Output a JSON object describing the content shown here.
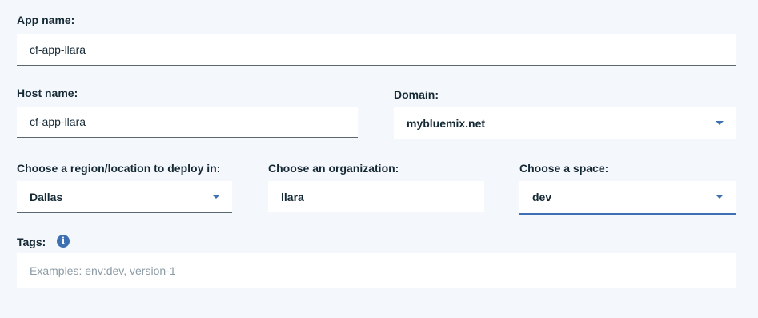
{
  "app_name": {
    "label": "App name:",
    "value": "cf-app-llara"
  },
  "host_name": {
    "label": "Host name:",
    "value": "cf-app-llara"
  },
  "domain": {
    "label": "Domain:",
    "value": "mybluemix.net",
    "icon": "chevron-down-icon"
  },
  "region": {
    "label": "Choose a region/location to deploy in:",
    "value": "Dallas",
    "icon": "chevron-down-icon"
  },
  "organization": {
    "label": "Choose an organization:",
    "value": "llara"
  },
  "space": {
    "label": "Choose a space:",
    "value": "dev",
    "icon": "chevron-down-icon"
  },
  "tags": {
    "label": "Tags:",
    "placeholder": "Examples: env:dev, version-1",
    "info_icon": "i",
    "info_icon_name": "info-icon"
  },
  "colors": {
    "background": "#f4f7fb",
    "accent": "#3d70b2",
    "text": "#152935",
    "placeholder": "#8c9ba5"
  }
}
